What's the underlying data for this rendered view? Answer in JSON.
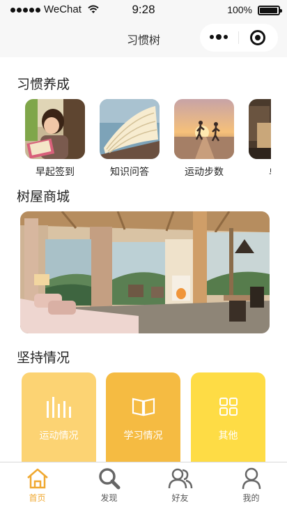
{
  "status_bar": {
    "carrier": "WeChat",
    "time": "9:28",
    "battery": "100%"
  },
  "nav": {
    "title": "习惯树"
  },
  "habits": {
    "title": "习惯养成",
    "items": [
      {
        "label": "早起签到",
        "icon": "reading-girl-image"
      },
      {
        "label": "知识问答",
        "icon": "book-pages-image"
      },
      {
        "label": "运动步数",
        "icon": "running-sunset-image"
      },
      {
        "label": "单词",
        "icon": "word-card-image"
      }
    ]
  },
  "shop": {
    "title": "树屋商城",
    "banner": "treehouse-room-image"
  },
  "persistence": {
    "title": "坚持情况",
    "cards": [
      {
        "label": "运动情况",
        "icon": "bars-icon",
        "color": "#fcd373"
      },
      {
        "label": "学习情况",
        "icon": "book-icon",
        "color": "#f5bb42"
      },
      {
        "label": "其他",
        "icon": "grid-icon",
        "color": "#fedc45"
      }
    ]
  },
  "tabs": [
    {
      "label": "首页",
      "icon": "home-icon",
      "active": true
    },
    {
      "label": "发现",
      "icon": "search-icon",
      "active": false
    },
    {
      "label": "好友",
      "icon": "friends-icon",
      "active": false
    },
    {
      "label": "我的",
      "icon": "profile-icon",
      "active": false
    }
  ],
  "colors": {
    "accent": "#f0a830"
  }
}
